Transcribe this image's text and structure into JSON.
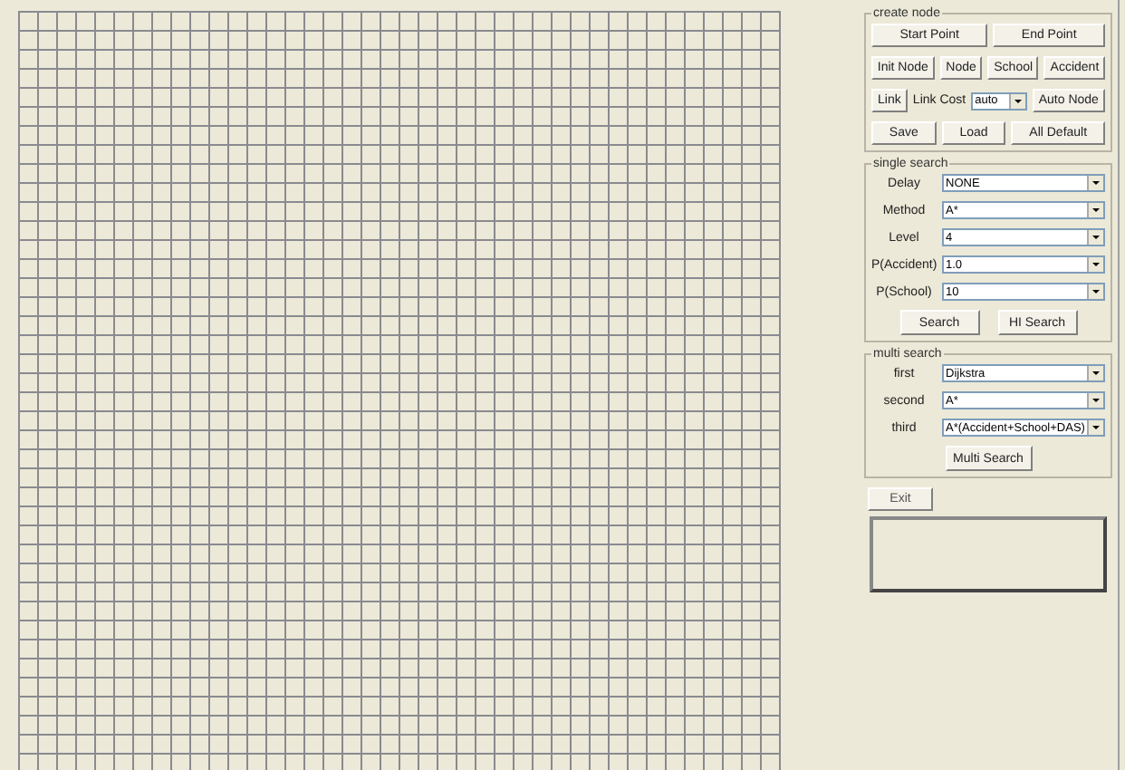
{
  "create_node": {
    "title": "create node",
    "rows": [
      {
        "items": [
          {
            "kind": "button",
            "label": "Start Point"
          },
          {
            "kind": "button",
            "label": "End Point"
          }
        ]
      },
      {
        "items": [
          {
            "kind": "button",
            "label": "Init Node"
          },
          {
            "kind": "button",
            "label": "Node"
          },
          {
            "kind": "button",
            "label": "School"
          },
          {
            "kind": "button",
            "label": "Accident"
          }
        ]
      },
      {
        "items": [
          {
            "kind": "button",
            "label": "Link"
          },
          {
            "kind": "label",
            "label": "Link Cost"
          },
          {
            "kind": "combo",
            "value": "auto"
          },
          {
            "kind": "button",
            "label": "Auto Node"
          }
        ]
      },
      {
        "items": [
          {
            "kind": "button",
            "label": "Save"
          },
          {
            "kind": "button",
            "label": "Load"
          },
          {
            "kind": "button",
            "label": "All Default"
          }
        ]
      }
    ]
  },
  "single_search": {
    "title": "single search",
    "fields": [
      {
        "label": "Delay",
        "value": "NONE"
      },
      {
        "label": "Method",
        "value": "A*"
      },
      {
        "label": "Level",
        "value": "4"
      },
      {
        "label": "P(Accident)",
        "value": "1.0"
      },
      {
        "label": "P(School)",
        "value": "10"
      }
    ],
    "buttons": [
      "Search",
      "HI Search"
    ]
  },
  "multi_search": {
    "title": "multi search",
    "fields": [
      {
        "label": "first",
        "value": "Dijkstra"
      },
      {
        "label": "second",
        "value": "A*"
      },
      {
        "label": "third",
        "value": "A*(Accident+School+DAS)"
      }
    ],
    "buttons": [
      "Multi Search"
    ]
  },
  "exit_button": "Exit"
}
